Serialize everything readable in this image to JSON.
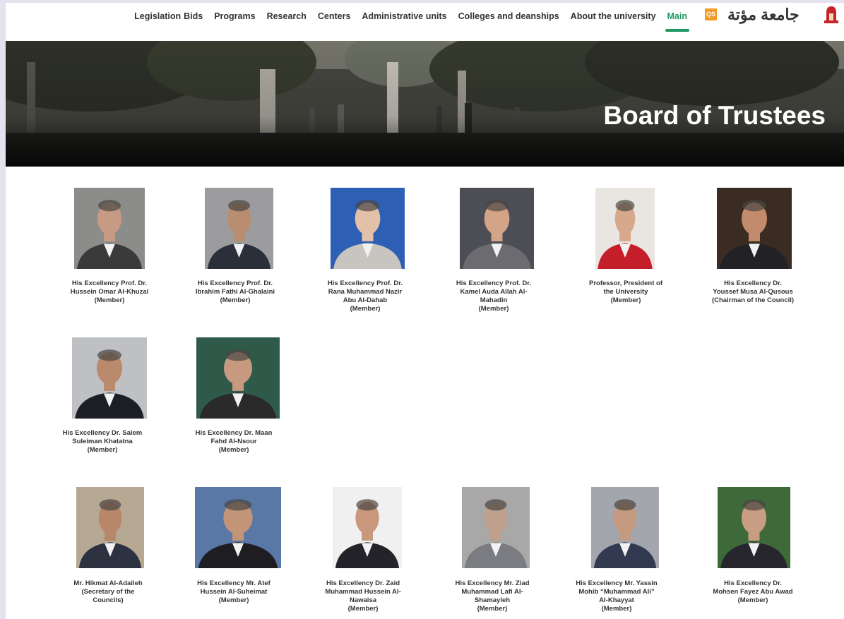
{
  "nav": {
    "items": [
      "Legislation",
      "Bids",
      "Programs",
      "Research",
      "Centers",
      "Administrative units",
      "Colleges and deanships",
      "About the university",
      "Main"
    ],
    "active": "Main"
  },
  "logo": {
    "text": "جامعة مؤتة",
    "badge": "QS"
  },
  "hero": {
    "title": "Board of Trustees"
  },
  "members": [
    {
      "name": "His Excellency Prof. Dr. Hussein Omar Al-Khuzai",
      "role": "(Member)",
      "jacket": "#3a3a3a",
      "bg": "#8c8c8a",
      "skin": "#c79a84"
    },
    {
      "name": "His Excellency Prof. Dr. Ibrahim Fathi Al-Ghalaini",
      "role": "(Member)",
      "jacket": "#2b2f3a",
      "bg": "#9c9c9e",
      "skin": "#b98d70"
    },
    {
      "name": "His Excellency Prof. Dr. Rana Muhammad Nazir Abu Al-Dahab",
      "role": "(Member)",
      "jacket": "#c8c4c0",
      "bg": "#2d5fb4",
      "skin": "#e3c0a8"
    },
    {
      "name": "His Excellency Prof. Dr. Kamel Auda Allah Al-Mahadin",
      "role": "(Member)",
      "jacket": "#6c6c70",
      "bg": "#4d4d55",
      "skin": "#d4a488"
    },
    {
      "name": "Professor, President of the University",
      "role": "(Member)",
      "jacket": "#c41e2a",
      "bg": "#e9e6e2",
      "skin": "#d8a88c"
    },
    {
      "name": "His Excellency Dr. Youssef Musa Al-Qusous",
      "role": "(Chairman of the Council)",
      "jacket": "#222226",
      "bg": "#3a2c22",
      "skin": "#c28b6c"
    },
    {
      "name": "His Excellency Dr. Salem Suleiman Khatatna",
      "role": "(Member)",
      "jacket": "#1c1e26",
      "bg": "#bfc0c4",
      "skin": "#b98a6c"
    },
    {
      "name": "His Excellency Dr. Maan Fahd Al-Nsour",
      "role": "(Member)",
      "jacket": "#2a2a2a",
      "bg": "#2f5a4a",
      "skin": "#c79a80"
    },
    {
      "name": "Mr. Hikmat Al-Adaileh",
      "role": "(Secretary of the Councils)",
      "jacket": "#2d3240",
      "bg": "#b6a892",
      "skin": "#b8876a"
    },
    {
      "name": "His Excellency Mr. Atef Hussein Al-Suheimat",
      "role": "(Member)",
      "jacket": "#1e1e22",
      "bg": "#5a78a6",
      "skin": "#c29478"
    },
    {
      "name": "His Excellency Dr. Zaid Muhammad Hussein Al-Nawaisa",
      "role": "(Member)",
      "jacket": "#25232a",
      "bg": "#f0f0f0",
      "skin": "#c9977c"
    },
    {
      "name": "His Excellency Mr. Ziad Muhammad Lafi Al-Shamayleh",
      "role": "(Member)",
      "jacket": "#7a7c82",
      "bg": "#a8a8a8",
      "skin": "#bfa08c"
    },
    {
      "name": "His Excellency Mr. Yassin Mohib “Muhammad Ali” Al-Khayyat",
      "role": "(Member)",
      "jacket": "#323a52",
      "bg": "#a4a6ae",
      "skin": "#c49a80"
    },
    {
      "name": "His Excellency Dr. Mohsen Fayez Abu Awad",
      "role": "(Member)",
      "jacket": "#26262c",
      "bg": "#3e6a3a",
      "skin": "#c99c84"
    }
  ]
}
